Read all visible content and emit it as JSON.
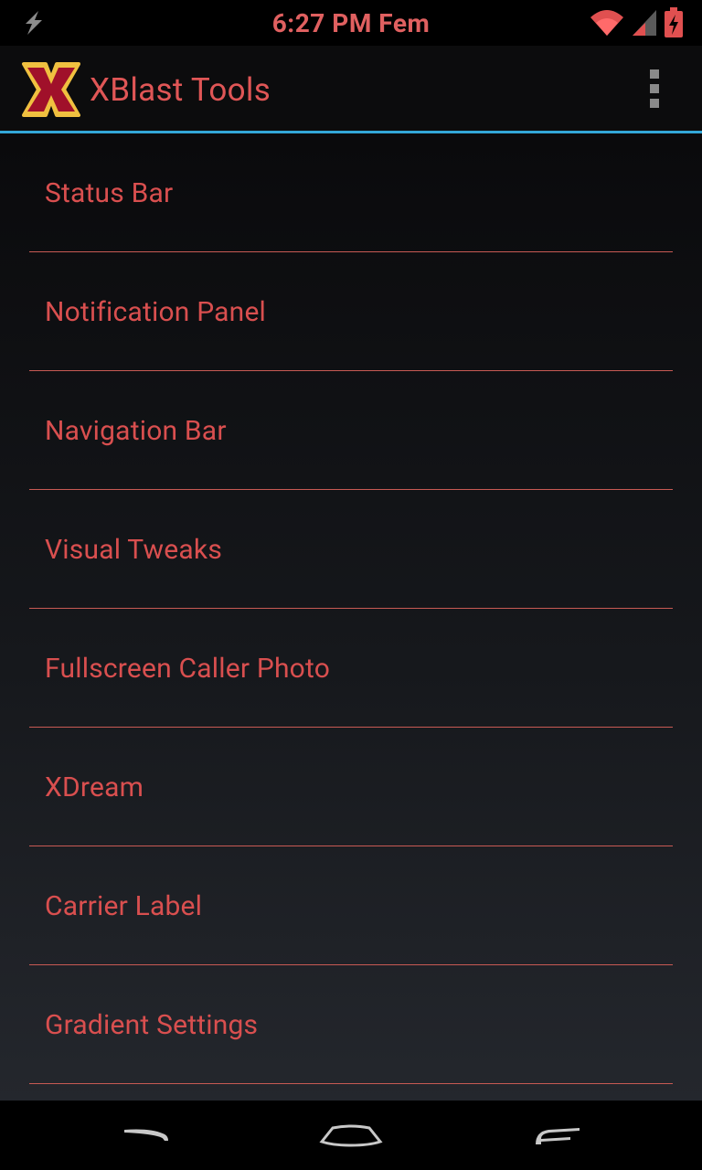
{
  "status_bar": {
    "time": "6:27 PM Fem",
    "icons": [
      "flash-icon",
      "wifi-icon",
      "signal-icon",
      "battery-charging-icon"
    ],
    "icon_color": "#e05050"
  },
  "action_bar": {
    "title": "XBlast Tools",
    "logo_letter": "X",
    "accent_color": "#33a7d8"
  },
  "menu_items": [
    {
      "label": "Status Bar"
    },
    {
      "label": "Notification Panel"
    },
    {
      "label": "Navigation Bar"
    },
    {
      "label": "Visual Tweaks"
    },
    {
      "label": "Fullscreen Caller Photo"
    },
    {
      "label": "XDream"
    },
    {
      "label": "Carrier Label"
    },
    {
      "label": "Gradient Settings"
    }
  ],
  "nav_bar": {
    "buttons": [
      "back-icon",
      "home-icon",
      "recent-apps-icon"
    ]
  },
  "theme": {
    "text_color": "#d94f4f",
    "divider_color": "#c85a54"
  }
}
